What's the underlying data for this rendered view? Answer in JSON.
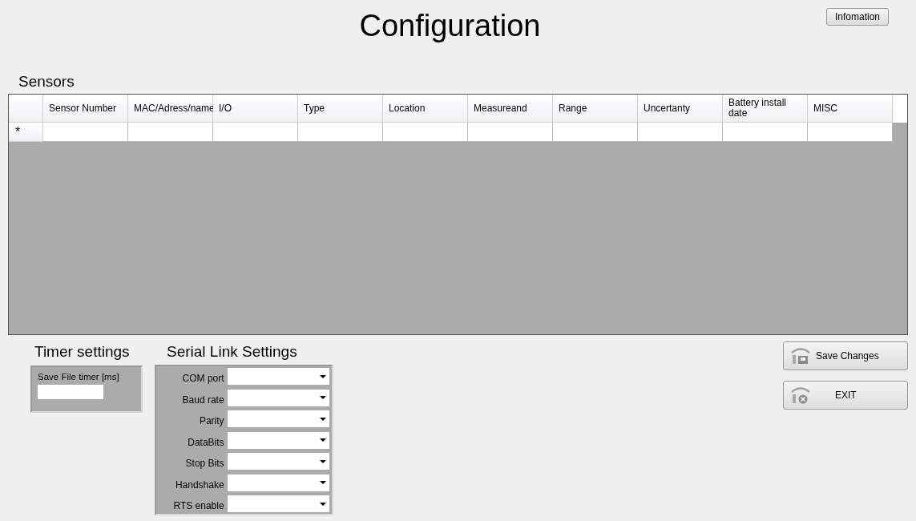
{
  "title": "Configuration",
  "info_button": "Infomation",
  "sensors": {
    "label": "Sensors",
    "columns": [
      "Sensor Number",
      "MAC/Adress/name",
      "I/O",
      "Type",
      "Location",
      "Measureand",
      "Range",
      "Uncertanty",
      "Battery install date",
      "MISC"
    ],
    "new_row_marker": "*"
  },
  "timer": {
    "label": "Timer settings",
    "field_label": "Save File timer [ms]"
  },
  "serial": {
    "label": "Serial Link Settings",
    "fields": [
      "COM port",
      "Baud rate",
      "Parity",
      "DataBits",
      "Stop Bits",
      "Handshake",
      "RTS enable"
    ]
  },
  "buttons": [
    {
      "kind": "save",
      "label": "Save Changes"
    },
    {
      "kind": "exit",
      "label": "EXIT"
    }
  ]
}
